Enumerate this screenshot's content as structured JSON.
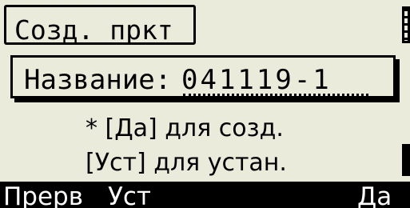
{
  "screen": {
    "title": "Созд. пркт"
  },
  "form": {
    "name_label": "Название:",
    "name_value": "041119-1"
  },
  "hints": {
    "line1": "* [Да] для созд.",
    "line2": "[Уст] для устан."
  },
  "softkeys": {
    "abort": "Прерв",
    "set": "Уст",
    "yes": "Да"
  },
  "colors": {
    "background": "#ebebdc",
    "foreground": "#000000",
    "softkey_text": "#ffffff"
  }
}
